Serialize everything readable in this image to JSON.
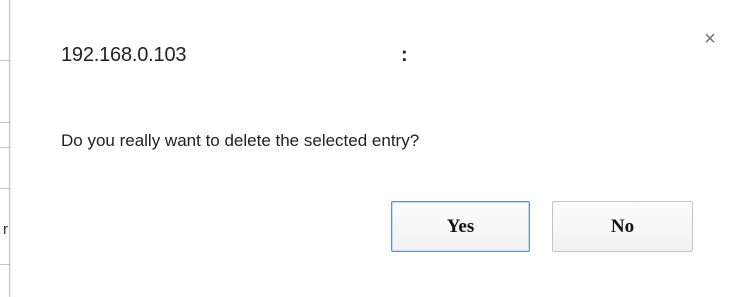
{
  "background": {
    "visible_char": "r"
  },
  "dialog": {
    "origin": "192.168.0.103",
    "origin_suffix": ":",
    "close_glyph": "×",
    "message": "Do you really want to delete the selected entry?",
    "buttons": {
      "yes_label": "Yes",
      "no_label": "No"
    },
    "colors": {
      "focus_border": "#4d90fe",
      "text": "#222222"
    }
  }
}
